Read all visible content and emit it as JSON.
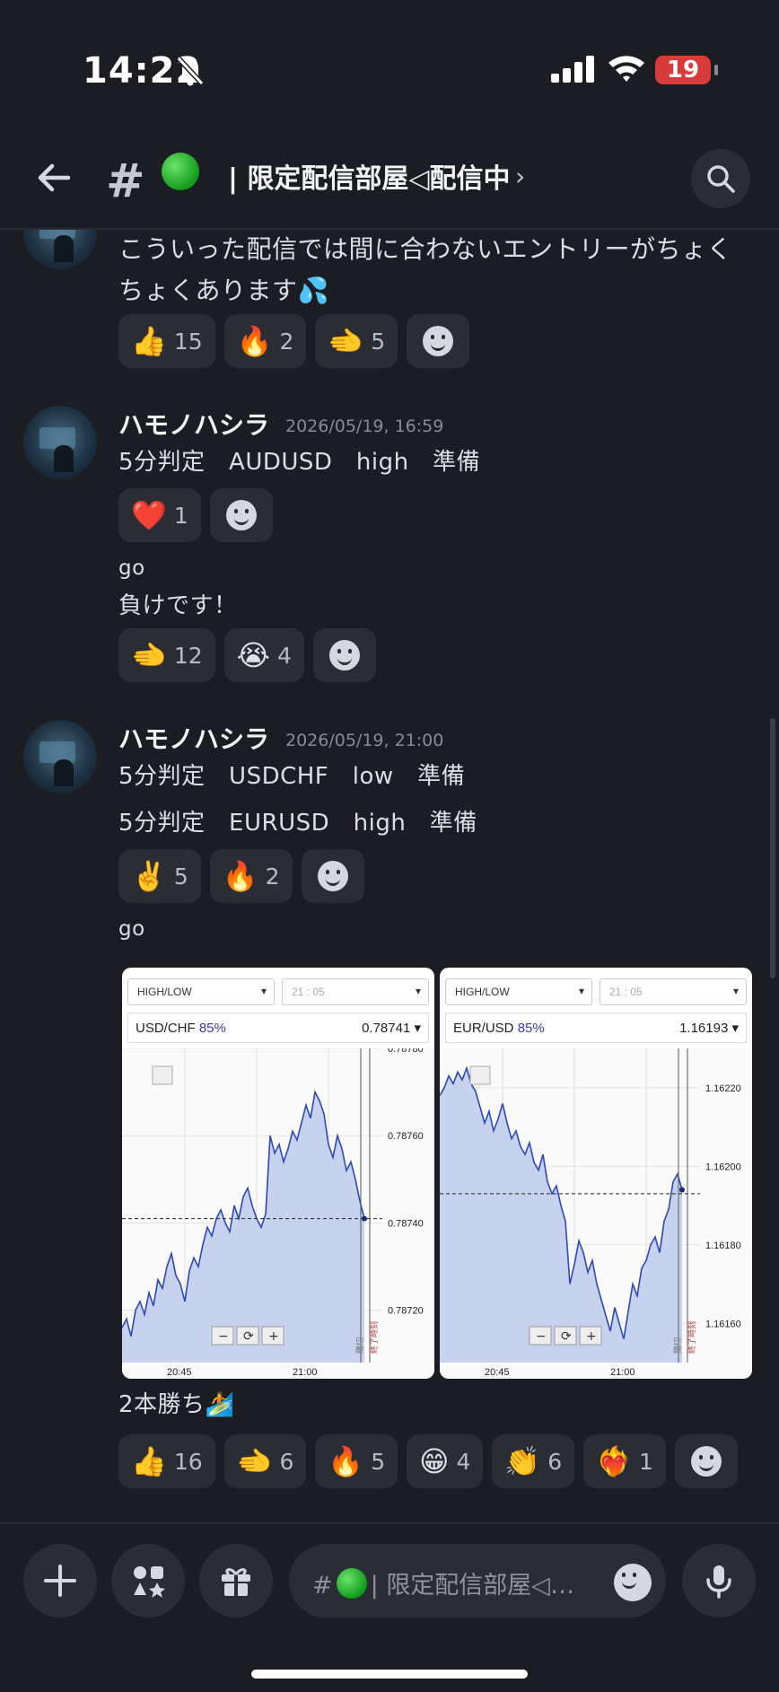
{
  "status": {
    "time": "14:22",
    "battery": "19"
  },
  "header": {
    "hash": "#",
    "title": "| 限定配信部屋◁配信中"
  },
  "messages": {
    "m0": {
      "line1": "こういった配信では間に合わないエントリーがちょく",
      "line2": "ちょくあります💦",
      "reactions": [
        {
          "emoji": "👍",
          "count": "15"
        },
        {
          "emoji": "🔥",
          "count": "2"
        },
        {
          "emoji": "🫲",
          "count": "5"
        }
      ]
    },
    "m1": {
      "author": "ハモノハシラ",
      "timestamp": "2026/05/19, 16:59",
      "text": "5分判定　AUDUSD　high　準備",
      "reactions": [
        {
          "emoji": "❤️",
          "count": "1"
        }
      ],
      "go": "go",
      "result": "負けです！",
      "reactions2": [
        {
          "emoji": "🫲",
          "count": "12"
        },
        {
          "emoji": "😭",
          "count": "4"
        }
      ]
    },
    "m2": {
      "author": "ハモノハシラ",
      "timestamp": "2026/05/19, 21:00",
      "text1": "5分判定　USDCHF　low　準備",
      "text2": "5分判定　EURUSD　high　準備",
      "reactions": [
        {
          "emoji": "✌️",
          "count": "5"
        },
        {
          "emoji": "🔥",
          "count": "2"
        }
      ],
      "go": "go",
      "result": "2本勝ち🏄",
      "reactions2": [
        {
          "emoji": "👍",
          "count": "16"
        },
        {
          "emoji": "🫲",
          "count": "6"
        },
        {
          "emoji": "🔥",
          "count": "5"
        },
        {
          "emoji": "😁",
          "count": "4"
        },
        {
          "emoji": "👏",
          "count": "6"
        },
        {
          "emoji": "❤️‍🔥",
          "count": "1"
        }
      ]
    }
  },
  "chart_data": [
    {
      "type": "area",
      "mode": "HIGH/LOW",
      "time_select": "21 : 05",
      "pair": "USD/CHF",
      "payout": "85%",
      "price": "0.78741",
      "ylim": [
        0.78708,
        0.7878
      ],
      "yticks": [
        "0.78780",
        "0.78760",
        "0.78740",
        "0.78720"
      ],
      "xticks": [
        "20:45",
        "21:00"
      ],
      "entry": 0.78741,
      "vertical_labels": [
        "購切",
        "終了時刻"
      ],
      "series": [
        0.78716,
        0.78718,
        0.78714,
        0.7872,
        0.78722,
        0.78719,
        0.78724,
        0.78721,
        0.78727,
        0.78725,
        0.7873,
        0.78733,
        0.78728,
        0.78726,
        0.78722,
        0.78729,
        0.78732,
        0.7873,
        0.78735,
        0.78739,
        0.78737,
        0.78741,
        0.78743,
        0.7874,
        0.78738,
        0.78744,
        0.78741,
        0.78746,
        0.78748,
        0.78744,
        0.78741,
        0.78739,
        0.78742,
        0.7876,
        0.78756,
        0.78758,
        0.78754,
        0.78757,
        0.78761,
        0.78759,
        0.78763,
        0.78767,
        0.78764,
        0.7877,
        0.78768,
        0.78765,
        0.78758,
        0.78755,
        0.7876,
        0.78757,
        0.78752,
        0.78754,
        0.7875,
        0.78745,
        0.78741
      ]
    },
    {
      "type": "area",
      "mode": "HIGH/LOW",
      "time_select": "21 : 05",
      "pair": "EUR/USD",
      "payout": "85%",
      "price": "1.16193",
      "ylim": [
        1.1615,
        1.1623
      ],
      "yticks": [
        "1.16220",
        "1.16200",
        "1.16180",
        "1.16160"
      ],
      "xticks": [
        "20:45",
        "21:00"
      ],
      "entry": 1.16193,
      "vertical_labels": [
        "購切",
        "終了時刻"
      ],
      "series": [
        1.16218,
        1.1622,
        1.16223,
        1.16221,
        1.16224,
        1.16222,
        1.16225,
        1.16221,
        1.16219,
        1.16215,
        1.16211,
        1.16214,
        1.16209,
        1.16212,
        1.16216,
        1.16211,
        1.16207,
        1.16209,
        1.16205,
        1.16203,
        1.16206,
        1.16201,
        1.16199,
        1.16203,
        1.16196,
        1.16193,
        1.16195,
        1.1619,
        1.16186,
        1.1617,
        1.16175,
        1.16181,
        1.16178,
        1.16173,
        1.16176,
        1.1617,
        1.16166,
        1.16162,
        1.16158,
        1.16164,
        1.1616,
        1.16156,
        1.16163,
        1.1617,
        1.16167,
        1.16174,
        1.16176,
        1.1618,
        1.16182,
        1.16178,
        1.16186,
        1.16189,
        1.16196,
        1.16198,
        1.16194
      ]
    }
  ],
  "input": {
    "placeholder": "限定配信部屋◁…"
  }
}
